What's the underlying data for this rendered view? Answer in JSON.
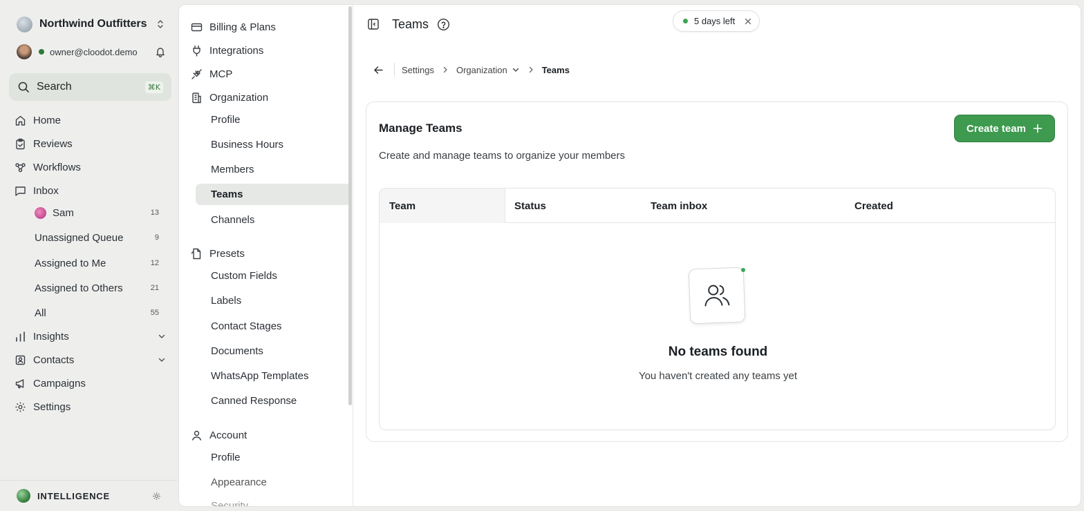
{
  "org": {
    "name": "Northwind Outfitters"
  },
  "user": {
    "email": "owner@cloodot.demo"
  },
  "search": {
    "label": "Search",
    "shortcut": "⌘K"
  },
  "nav": {
    "home": "Home",
    "reviews": "Reviews",
    "workflows": "Workflows",
    "inbox": "Inbox",
    "inbox_items": [
      {
        "label": "Sam",
        "count": "13"
      },
      {
        "label": "Unassigned Queue",
        "count": "9"
      },
      {
        "label": "Assigned to Me",
        "count": "12"
      },
      {
        "label": "Assigned to Others",
        "count": "21"
      },
      {
        "label": "All",
        "count": "55"
      }
    ],
    "insights": "Insights",
    "contacts": "Contacts",
    "campaigns": "Campaigns",
    "settings": "Settings"
  },
  "bottom": {
    "label": "INTELLIGENCE"
  },
  "settings_nav": {
    "billing": "Billing & Plans",
    "integrations": "Integrations",
    "mcp": "MCP",
    "organization": "Organization",
    "org_items": [
      "Profile",
      "Business Hours",
      "Members",
      "Teams",
      "Channels"
    ],
    "presets": "Presets",
    "preset_items": [
      "Custom Fields",
      "Labels",
      "Contact Stages",
      "Documents",
      "WhatsApp Templates",
      "Canned Response"
    ],
    "account": "Account",
    "account_items": [
      "Profile",
      "Appearance",
      "Security"
    ]
  },
  "header": {
    "title": "Teams",
    "trial": "5 days left"
  },
  "breadcrumb": {
    "settings": "Settings",
    "organization": "Organization",
    "current": "Teams"
  },
  "card": {
    "title": "Manage Teams",
    "description": "Create and manage teams to organize your members",
    "create_label": "Create team"
  },
  "table": {
    "columns": [
      "Team",
      "Status",
      "Team inbox",
      "Created"
    ]
  },
  "empty": {
    "title": "No teams found",
    "subtitle": "You haven't created any teams yet"
  },
  "colors": {
    "accent": "#3d9a4e",
    "status_online": "#2f7a3a"
  }
}
